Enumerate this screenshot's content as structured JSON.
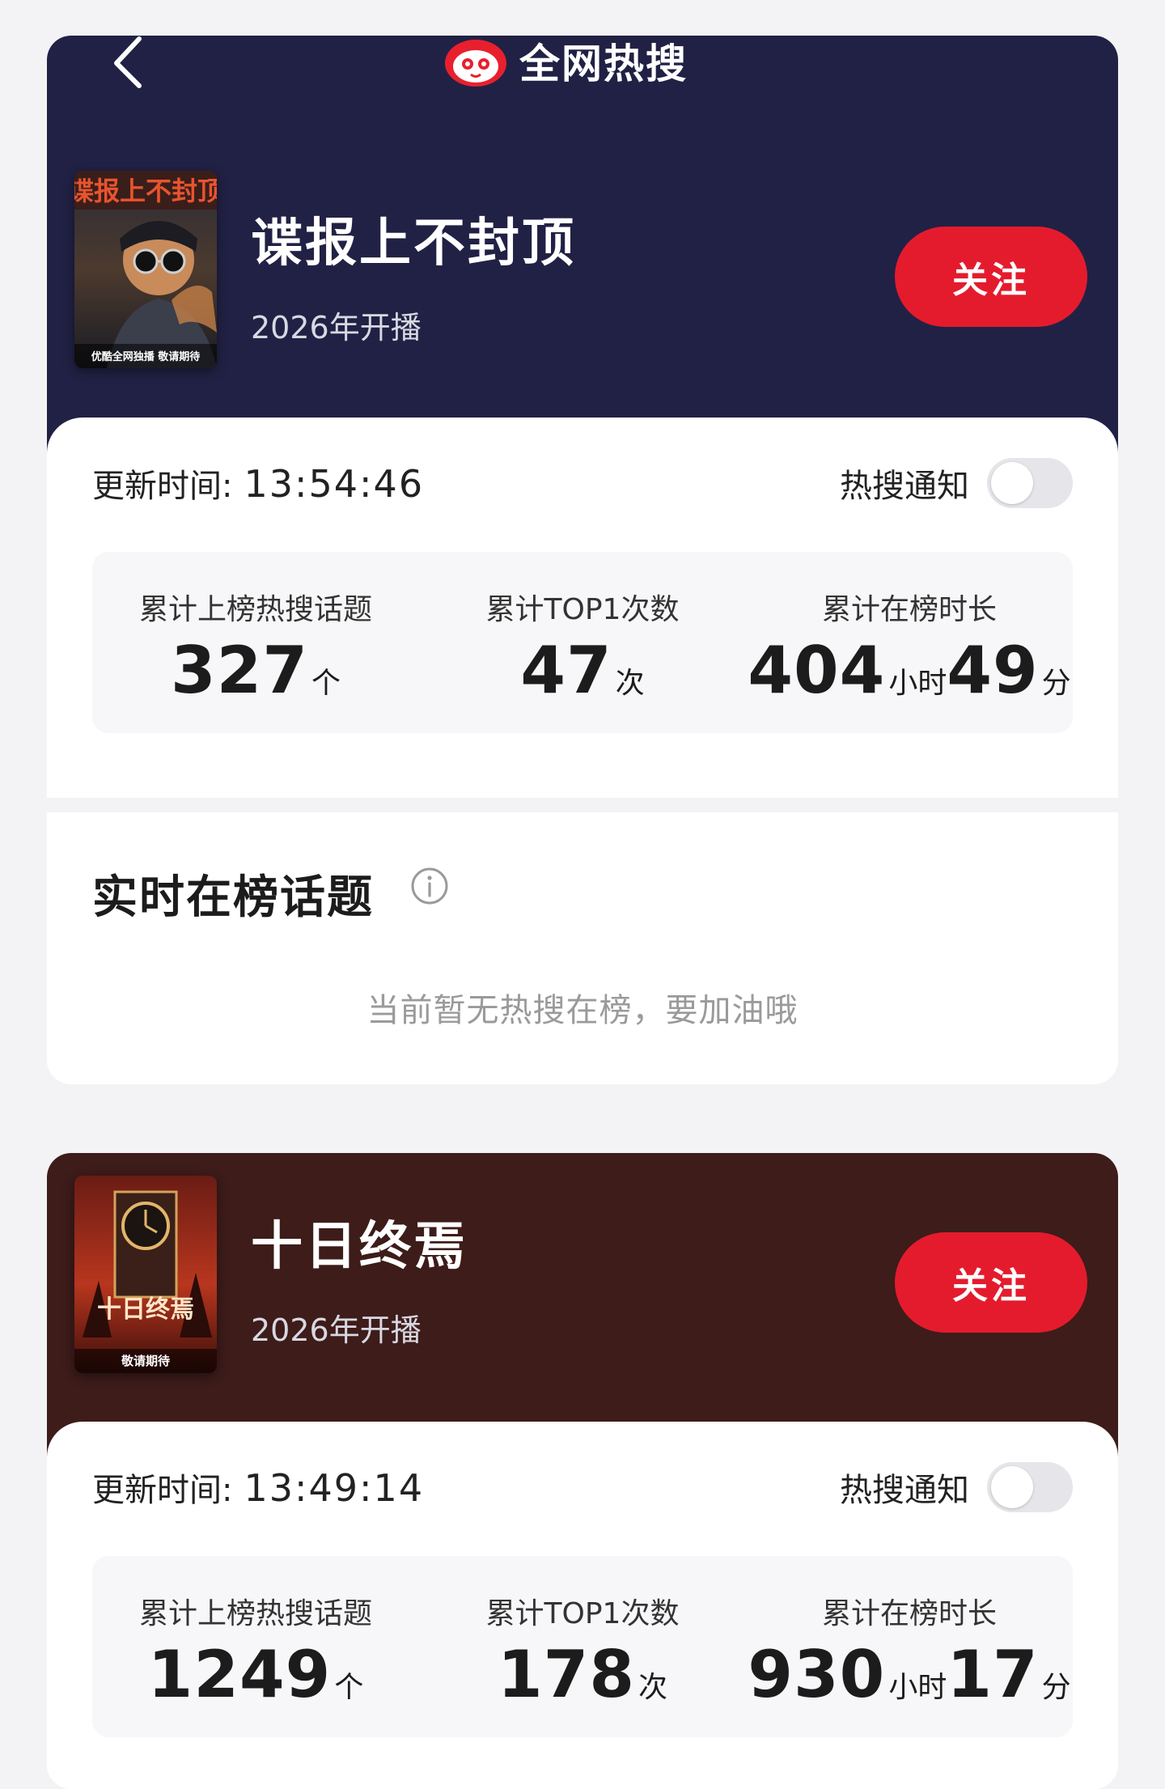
{
  "header": {
    "brand_name": "全网热搜"
  },
  "shows": [
    {
      "title": "谍报上不封顶",
      "subtitle": "2026年开播",
      "poster_title": "谍报上不封顶",
      "poster_footer": "优酷全网独播 敬请期待",
      "follow_label": "关注",
      "update_label": "更新时间:",
      "update_time": "13:54:46",
      "notify_label": "热搜通知",
      "notify_on": false,
      "stats": [
        {
          "label": "累计上榜热搜话题",
          "value": "327",
          "unit": "个"
        },
        {
          "label": "累计TOP1次数",
          "value": "47",
          "unit": "次"
        },
        {
          "label": "累计在榜时长",
          "hours": "404",
          "hours_unit": "小时",
          "minutes": "49",
          "minutes_unit": "分"
        }
      ],
      "section_title": "实时在榜话题",
      "empty_text": "当前暂无热搜在榜，要加油哦"
    },
    {
      "title": "十日终焉",
      "subtitle": "2026年开播",
      "poster_title": "十日终焉",
      "poster_footer": "敬请期待",
      "follow_label": "关注",
      "update_label": "更新时间:",
      "update_time": "13:49:14",
      "notify_label": "热搜通知",
      "notify_on": false,
      "stats": [
        {
          "label": "累计上榜热搜话题",
          "value": "1249",
          "unit": "个"
        },
        {
          "label": "累计TOP1次数",
          "value": "178",
          "unit": "次"
        },
        {
          "label": "累计在榜时长",
          "hours": "930",
          "hours_unit": "小时",
          "minutes": "17",
          "minutes_unit": "分"
        }
      ]
    }
  ],
  "colors": {
    "hero_1": "#212145",
    "hero_2": "#3d1c1a",
    "follow_button": "#e41b2d",
    "page_bg": "#f3f3f5"
  }
}
